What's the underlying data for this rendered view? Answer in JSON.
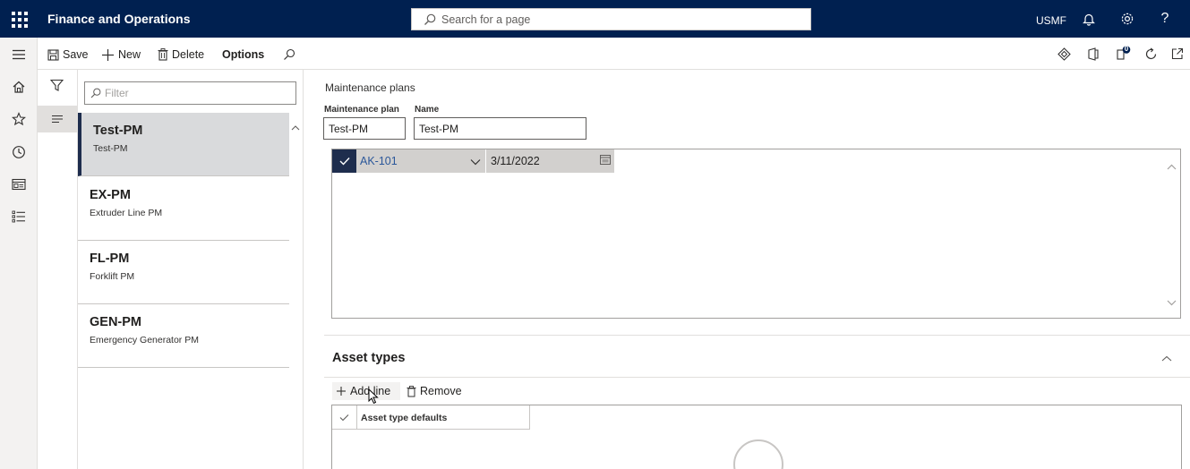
{
  "app": {
    "title": "Finance and Operations",
    "company": "USMF"
  },
  "search": {
    "placeholder": "Search for a page"
  },
  "actions": {
    "save": "Save",
    "new": "New",
    "delete": "Delete",
    "options": "Options"
  },
  "badge": {
    "count": "0"
  },
  "list": {
    "filter_placeholder": "Filter",
    "items": [
      {
        "title": "Test-PM",
        "subtitle": "Test-PM"
      },
      {
        "title": "EX-PM",
        "subtitle": "Extruder Line PM"
      },
      {
        "title": "FL-PM",
        "subtitle": "Forklift PM"
      },
      {
        "title": "GEN-PM",
        "subtitle": "Emergency Generator PM"
      }
    ]
  },
  "details": {
    "caption": "Maintenance plans",
    "plan_label": "Maintenance plan",
    "plan_value": "Test-PM",
    "name_label": "Name",
    "name_value": "Test-PM",
    "grid_row": {
      "asset": "AK-101",
      "date": "3/11/2022"
    }
  },
  "asset_types": {
    "title": "Asset types",
    "add_line": "Add line",
    "remove": "Remove",
    "column": "Asset type defaults"
  },
  "colors": {
    "navbar": "#002050",
    "selected_marker": "#1e2d4d",
    "link": "#2b579a"
  }
}
